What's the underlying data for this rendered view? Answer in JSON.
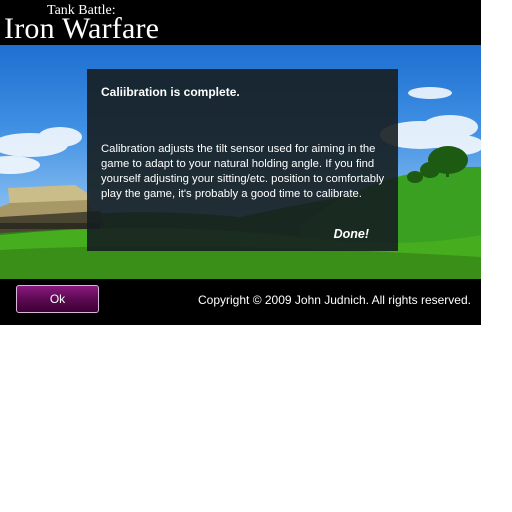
{
  "header": {
    "subtitle": "Tank Battle:",
    "title": "Iron Warfare"
  },
  "dialog": {
    "heading": "Caliibration is complete.",
    "body": "Calibration adjusts the tilt sensor used for aiming in the game to adapt to your natural holding angle. If you find yourself adjusting your sitting/etc. position to comfortably play the game, it's probably a good time to calibrate.",
    "done_label": "Done!"
  },
  "footer": {
    "ok_label": "Ok",
    "copyright": "Copyright © 2009 John Judnich. All rights reserved."
  },
  "colors": {
    "ok_button": "#6b1262",
    "dialog_bg": "#161e20",
    "sky": "#3f8fe3",
    "grass": "#3c9a1c"
  }
}
